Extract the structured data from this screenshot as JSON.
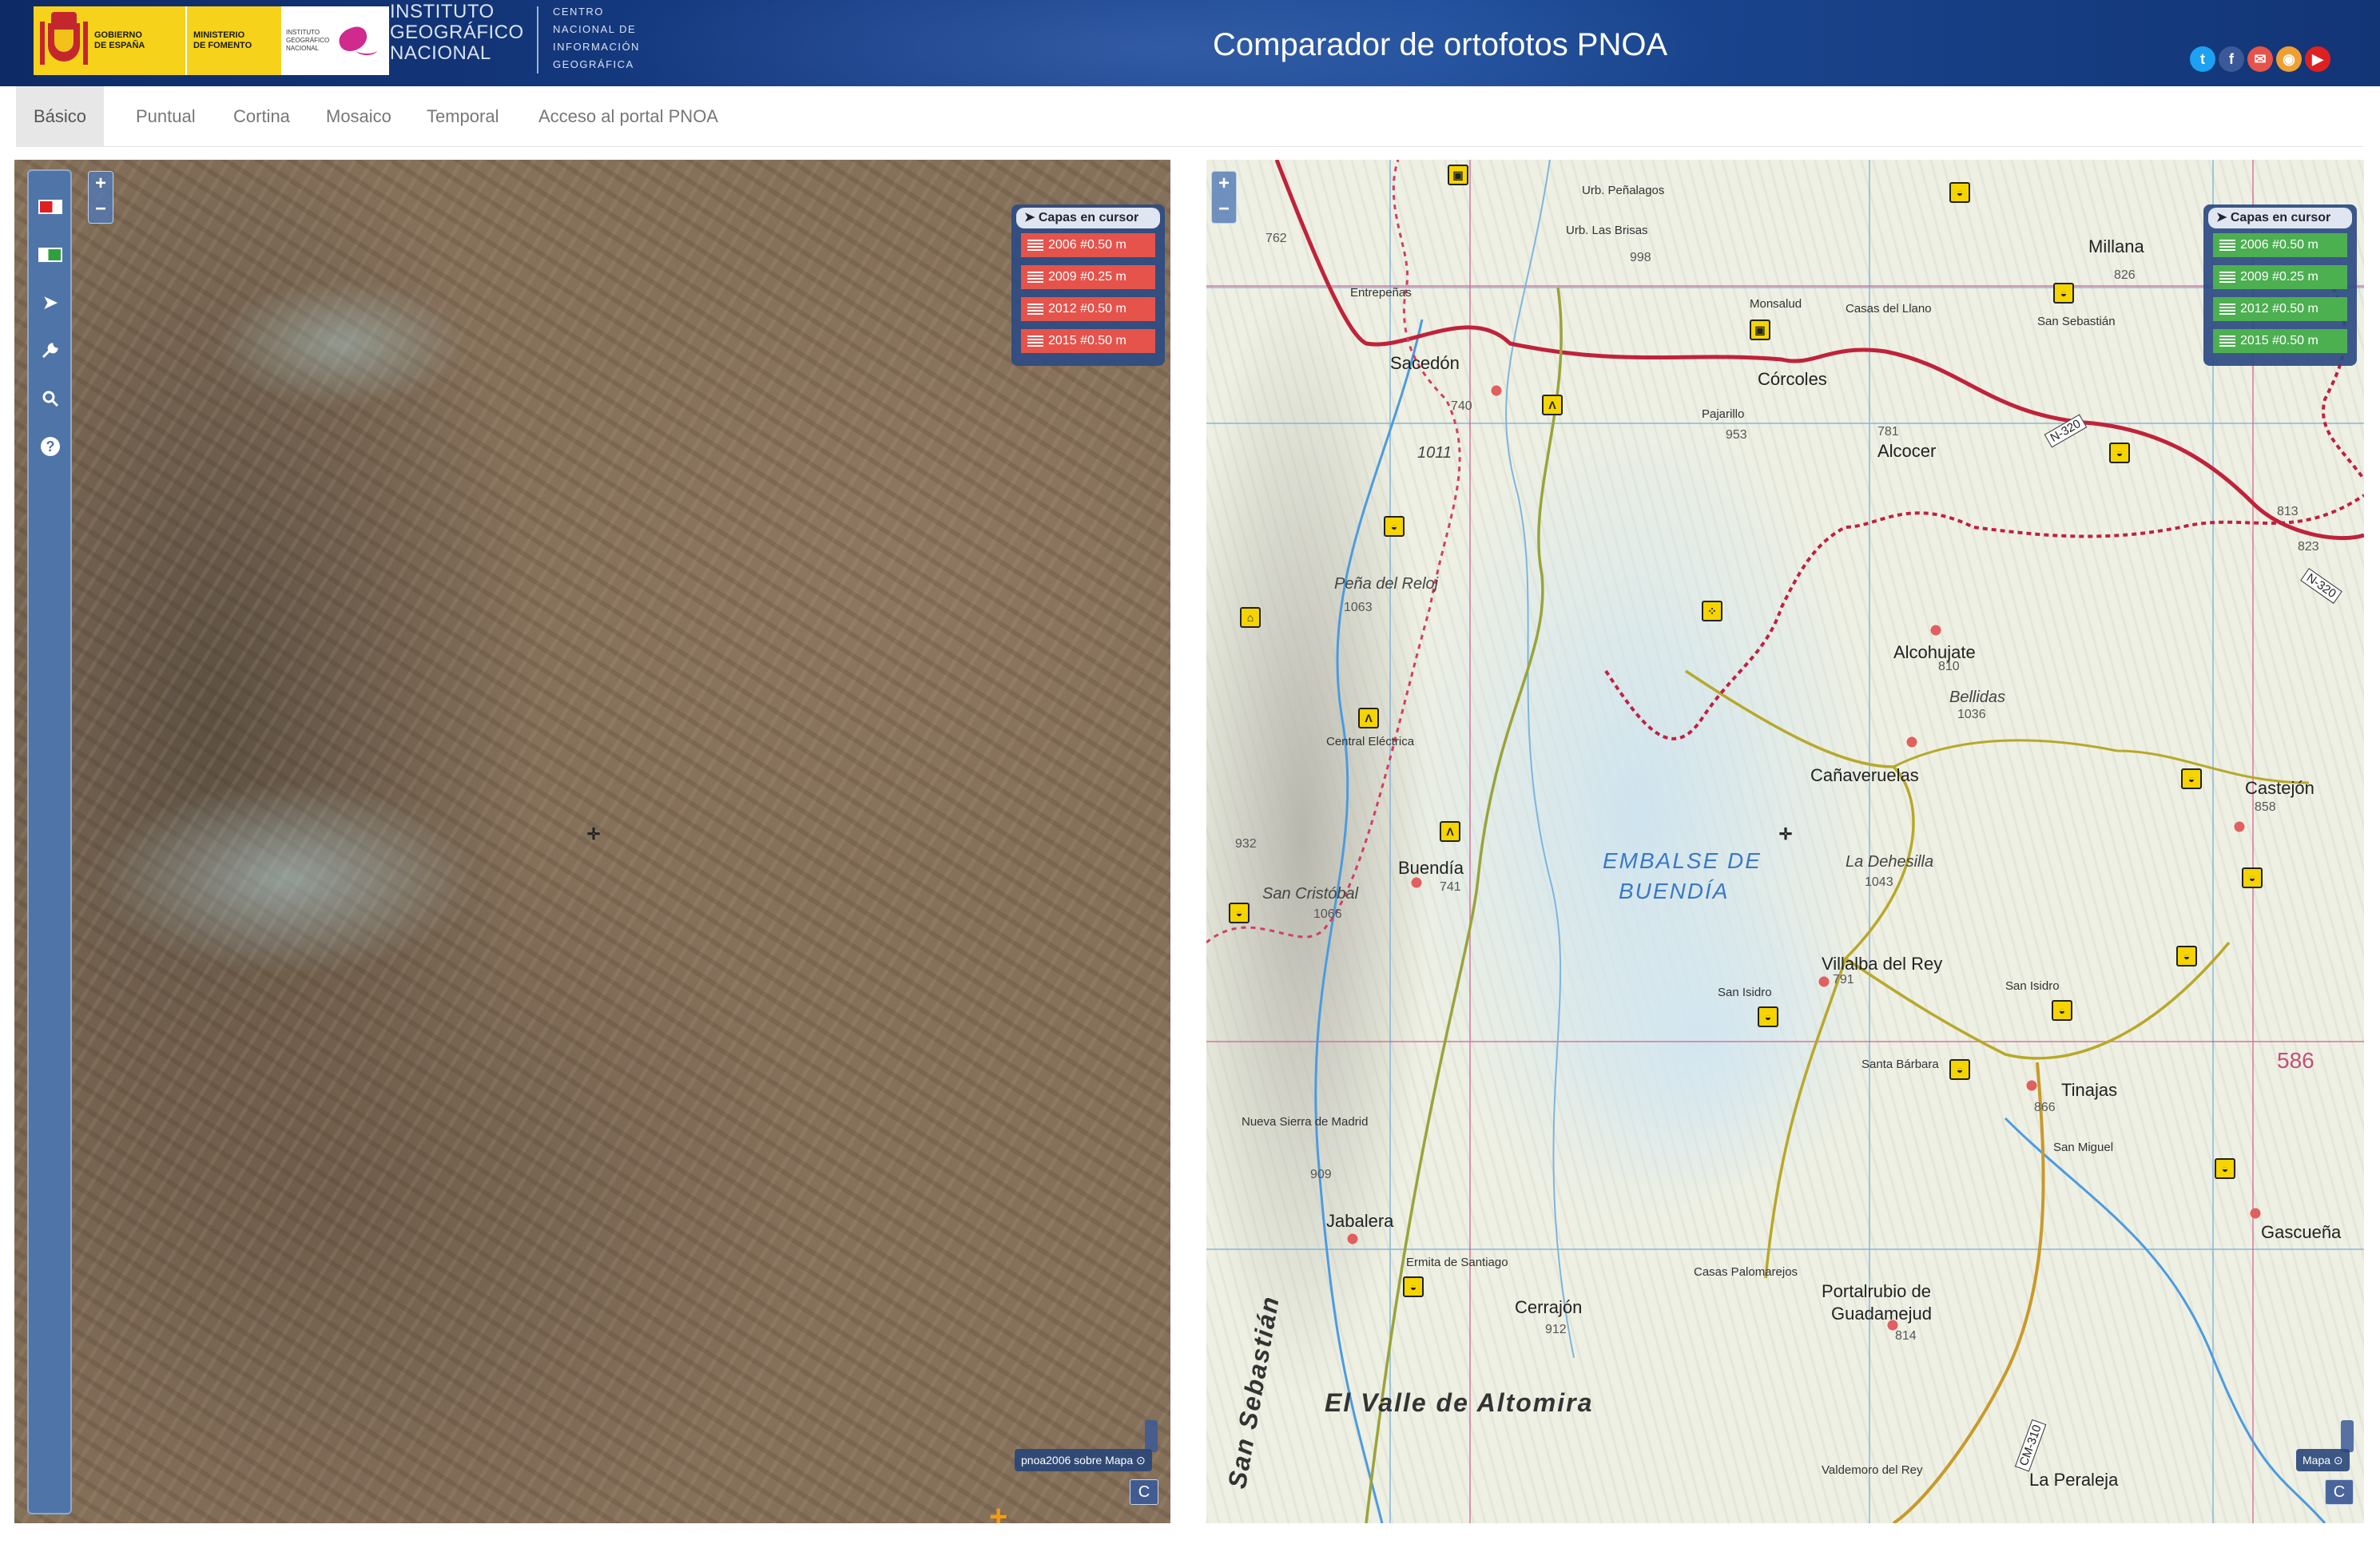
{
  "header": {
    "gobierno": "GOBIERNO\nDE ESPAÑA",
    "ministerio": "MINISTERIO\nDE FOMENTO",
    "instituto_small": "INSTITUTO\nGEOGRÁFICO\nNACIONAL",
    "ign_line1": "INSTITUTO",
    "ign_line2": "GEOGRÁFICO",
    "ign_line3": "NACIONAL",
    "cnig_line1": "CENTRO",
    "cnig_line2": "NACIONAL DE",
    "cnig_line3": "INFORMACIÓN",
    "cnig_line4": "GEOGRÁFICA",
    "title": "Comparador de ortofotos PNOA",
    "social": [
      {
        "icon": "twitter-icon",
        "glyph": "t",
        "color": "#1da1f2"
      },
      {
        "icon": "facebook-icon",
        "glyph": "f",
        "color": "#3b5998"
      },
      {
        "icon": "email-icon",
        "glyph": "✉",
        "color": "#e5534b"
      },
      {
        "icon": "rss-icon",
        "glyph": "◉",
        "color": "#f0a030"
      },
      {
        "icon": "youtube-icon",
        "glyph": "▶",
        "color": "#e02020"
      }
    ]
  },
  "nav": {
    "tabs": [
      {
        "label": "Básico",
        "active": true
      },
      {
        "label": "Puntual",
        "active": false
      },
      {
        "label": "Cortina",
        "active": false
      },
      {
        "label": "Mosaico",
        "active": false
      },
      {
        "label": "Temporal",
        "active": false
      },
      {
        "label": "Acceso al portal PNOA",
        "active": false
      }
    ]
  },
  "left_map": {
    "zoom_in": "+",
    "zoom_out": "−",
    "tools": [
      {
        "icon": "red-flag-icon"
      },
      {
        "icon": "green-flag-icon"
      },
      {
        "icon": "pointer-icon",
        "glyph": "➤"
      },
      {
        "icon": "wrench-icon",
        "glyph": "🔧"
      },
      {
        "icon": "search-icon",
        "glyph": "🔍"
      },
      {
        "icon": "help-icon",
        "glyph": "?"
      }
    ],
    "layers_header": "Capas en cursor",
    "layers": [
      "2006 #0.50 m",
      "2009 #0.25 m",
      "2012 #0.50 m",
      "2015 #0.50 m"
    ],
    "basemap_label": "pnoa2006 sobre Mapa",
    "corner_button": "C",
    "crosshair": "✛"
  },
  "right_map": {
    "zoom_in": "+",
    "zoom_out": "−",
    "layers_header": "Capas en cursor",
    "layers": [
      "2006 #0.50 m",
      "2009 #0.25 m",
      "2012 #0.50 m",
      "2015 #0.50 m"
    ],
    "basemap_label": "Mapa",
    "corner_button": "C",
    "crosshair": "✛",
    "labels": {
      "sacedon": "Sacedón",
      "corcoles": "Córcoles",
      "pajarillo": "Pajarillo",
      "alcocer": "Alcocer",
      "millana": "Millana",
      "urb_penalagos": "Urb. Peñalagos",
      "urb_brisas": "Urb. Las Brisas",
      "entrepenas": "Entrepeñas",
      "buendia": "Buendía",
      "canaveruelas": "Cañaveruelas",
      "alcohujate": "Alcohujate",
      "bellidas": "Bellidas",
      "castejon": "Castejón",
      "la_dehesilla": "La Dehesilla",
      "villalba": "Villalba del Rey",
      "tinajas": "Tinajas",
      "gascuena": "Gascueña",
      "jabalera": "Jabalera",
      "cerrajon": "Cerrajón",
      "portalrubio": "Portalrubio de",
      "guadamejud": "Guadamejud",
      "la_peraleja": "La Peraleja",
      "valdemoro": "Valdemoro del Rey",
      "san_castobal": "San Cristóbal",
      "pena_reloj": "Peña del Reloj",
      "embalse1": "EMBALSE DE",
      "embalse2": "BUENDÍA",
      "valle": "El Valle de Altomira",
      "sebastian": "San Sebastián",
      "nueva_sierra": "Nueva Sierra de Madrid",
      "central": "Central Eléctrica",
      "monsalud": "Monsalud",
      "san_sebastian": "San Sebastián",
      "san_miguel": "San Miguel",
      "san_isidro1": "San Isidro",
      "san_isidro2": "San Isidro",
      "santa_barbara": "Santa Bárbara",
      "casas_palomarejos": "Casas Palomarejos",
      "ermita_santiago": "Ermita de Santiago",
      "casas_llano": "Casas del Llano",
      "n320a": "N-320",
      "n320b": "N-320",
      "cm310": "CM-310",
      "grid586": "586",
      "h1011": "1011",
      "h1063": "1063",
      "h1066": "1066",
      "h953": "953",
      "h781": "781",
      "h998": "998",
      "h826": "826",
      "h813": "813",
      "h823": "823",
      "h810": "810",
      "h1036": "1036",
      "h1043": "1043",
      "h791": "791",
      "h741": "741",
      "h866": "866",
      "h909": "909",
      "h912": "912",
      "h814": "814",
      "h858": "858",
      "h762": "762",
      "h932": "932",
      "h740": "740"
    }
  }
}
